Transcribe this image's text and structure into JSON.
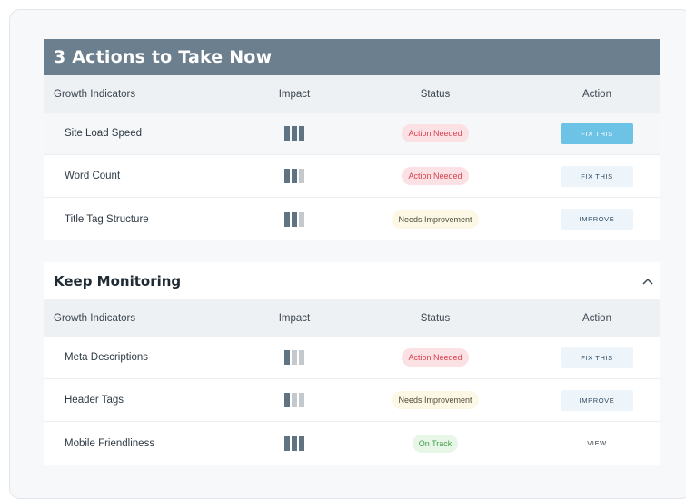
{
  "sections": [
    {
      "title": "3 Actions to Take Now",
      "columns": [
        "Growth Indicators",
        "Impact",
        "Status",
        "Action"
      ],
      "rows": [
        {
          "indicator": "Site Load Speed",
          "impact": 3,
          "status": "Action Needed",
          "status_tone": "red",
          "action": "FIX THIS",
          "action_style": "active"
        },
        {
          "indicator": "Word Count",
          "impact": 2,
          "status": "Action Needed",
          "status_tone": "red",
          "action": "FIX THIS",
          "action_style": "light"
        },
        {
          "indicator": "Title Tag Structure",
          "impact": 2,
          "status": "Needs Improvement",
          "status_tone": "yellow",
          "action": "IMPROVE",
          "action_style": "light"
        }
      ]
    },
    {
      "title": "Keep Monitoring",
      "columns": [
        "Growth Indicators",
        "Impact",
        "Status",
        "Action"
      ],
      "rows": [
        {
          "indicator": "Meta Descriptions",
          "impact": 1,
          "status": "Action Needed",
          "status_tone": "red",
          "action": "FIX THIS",
          "action_style": "light"
        },
        {
          "indicator": "Header Tags",
          "impact": 1,
          "status": "Needs Improvement",
          "status_tone": "yellow",
          "action": "IMPROVE",
          "action_style": "light"
        },
        {
          "indicator": "Mobile Friendliness",
          "impact": 3,
          "status": "On Track",
          "status_tone": "green",
          "action": "VIEW",
          "action_style": "plain"
        }
      ]
    }
  ],
  "icons": {
    "collapse": "chevron-up-icon"
  },
  "colors": {
    "banner": "#6b7f8e",
    "active_button": "#6cc3e6",
    "impact_on": "#5f7382",
    "impact_off": "#c4c9ce"
  }
}
